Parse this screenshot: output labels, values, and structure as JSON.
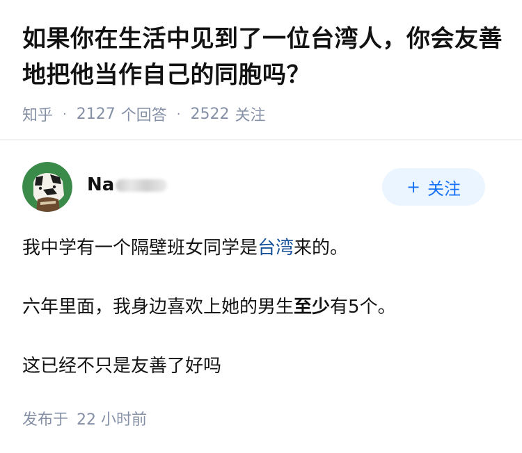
{
  "question": {
    "title": "如果你在生活中见到了一位台湾人，你会友善地把他当作自己的同胞吗？",
    "source": "知乎",
    "answers_count": "2127",
    "answers_label": "个回答",
    "followers_count": "2522",
    "followers_label": "关注",
    "separator": "·"
  },
  "author": {
    "name_visible": "Na",
    "follow_icon": "+",
    "follow_label": "关注"
  },
  "answer": {
    "p1_before": "我中学有一个隔壁班女同学是",
    "p1_link": "台湾",
    "p1_after": "来的。",
    "p2_before": "六年里面，我身边喜欢上她的男生",
    "p2_bold": "至少",
    "p2_after": "有5个。",
    "p3": "这已经不只是友善了好吗"
  },
  "post": {
    "label": "发布于",
    "time": "22 小时前"
  },
  "colors": {
    "meta_gray": "#8590a6",
    "link_blue": "#175199",
    "follow_blue": "#1772f6",
    "follow_bg": "#ebf5ff",
    "avatar_green": "#3a8a4a"
  },
  "icons": {
    "avatar": "cartoon-avatar-icon",
    "follow": "plus-icon"
  }
}
